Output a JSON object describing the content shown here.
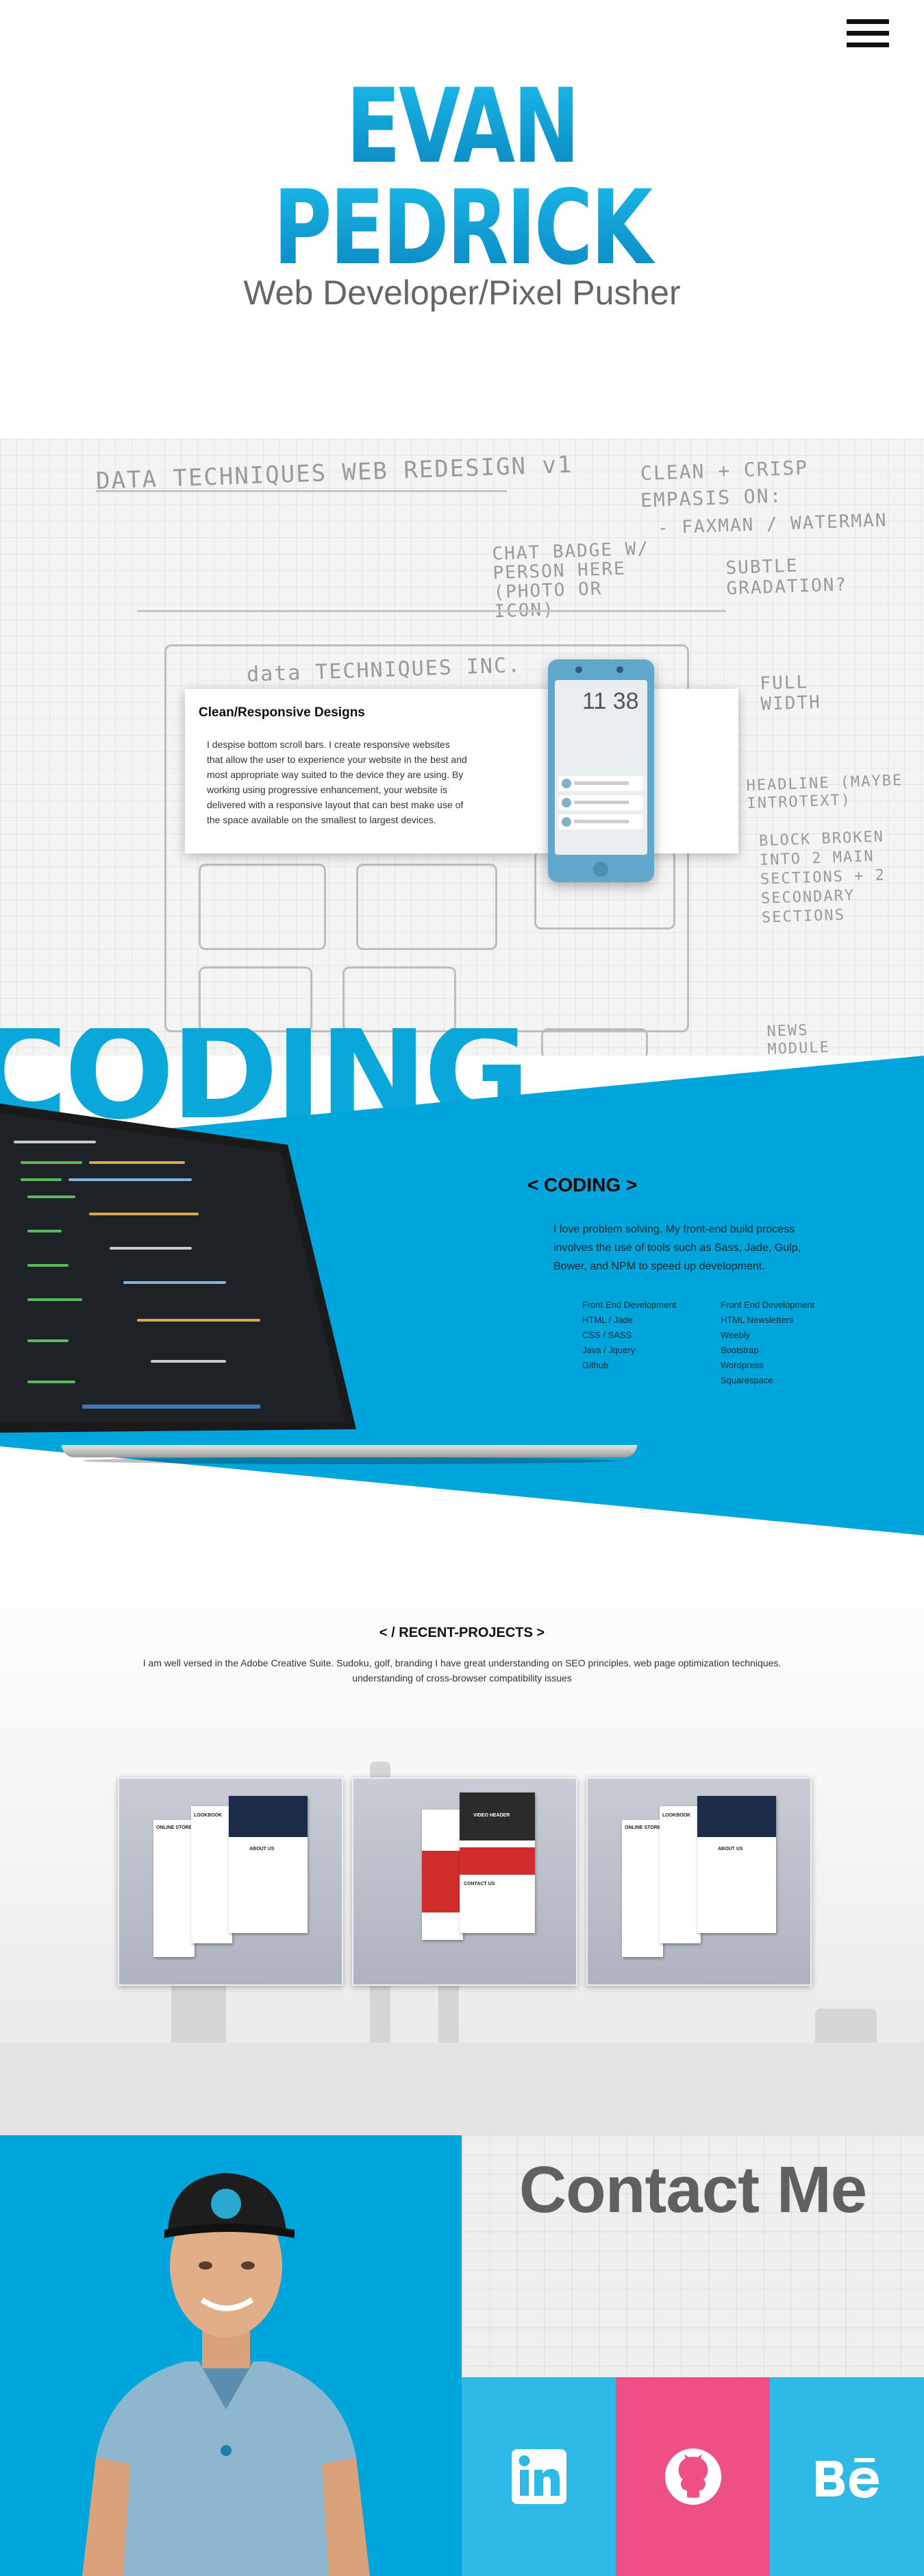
{
  "header": {
    "menu_icon": "hamburger-icon",
    "first_name": "EVAN",
    "last_name": "PEDRICK",
    "subtitle": "Web Developer/Pixel Pusher"
  },
  "responsive": {
    "title": "Clean/Responsive Designs",
    "body": "I despise bottom scroll bars. I create responsive websites that allow the user to experience your website in the best and most appropriate way suited to the device they are using. By working using progressive enhancement, your website is delivered with a responsive layout that can best make use of the space available on the smallest to largest devices.",
    "phone_time": "11 38",
    "sketch_notes": [
      "DATA TECHNIQUES WEB REDESIGN v1",
      "CLEAN + CRISP",
      "EMPASIS ON:",
      "- FAXMAN / WATERMAN",
      "CHAT BADGE W/ PERSON HERE (PHOTO OR ICON)",
      "SUBTLE GRADATION?",
      "FULL WIDTH",
      "HEADLINE (MAYBE INTROTEXT)",
      "BLOCK BROKEN INTO 2 MAIN SECTIONS + 2 SECONDARY SECTIONS",
      "NEWS MODULE",
      "data TECHNIQUES INC."
    ]
  },
  "coding": {
    "big_word": "CODING",
    "title": "< CODING >",
    "description": "I love problem solving. My front-end build process involves the use of tools such as Sass, Jade, Gulp, Bower, and NPM to speed up development.",
    "skills_left": [
      "Front End Development",
      "HTML / Jade",
      "CSS / SASS",
      "Java / Jquery",
      "Github"
    ],
    "skills_right": [
      "Front End Development",
      "HTML Newsletters",
      "Weebly",
      "Bootstrap",
      "Wordpress",
      "Squarespace"
    ]
  },
  "projects": {
    "title": "< / RECENT-PROJECTS >",
    "description": "I am well versed in the Adobe Creative Suite. Sudoku, golf, branding I have great understanding on SEO principles. web page optimization techniques. understanding of cross-browser compatibility issues",
    "items": [
      {
        "labels": [
          "ONLINE STORE",
          "LOOKBOOK",
          "ABOUT US"
        ]
      },
      {
        "labels": [
          "VIDEO HEADER",
          "CONTACT US"
        ]
      },
      {
        "labels": [
          "ONLINE STORE",
          "LOOKBOOK",
          "ABOUT US"
        ]
      }
    ]
  },
  "contact": {
    "title": "Contact Me",
    "social": [
      {
        "name": "LinkedIn",
        "icon": "linkedin-icon",
        "color": "#2fb9e6"
      },
      {
        "name": "GitHub",
        "icon": "github-icon",
        "color": "#ed4f86"
      },
      {
        "name": "Behance",
        "icon": "behance-icon",
        "color": "#2fb9e6"
      }
    ]
  },
  "colors": {
    "accent": "#00a6db",
    "pink": "#ed4f86",
    "heading_gray": "#606060"
  }
}
